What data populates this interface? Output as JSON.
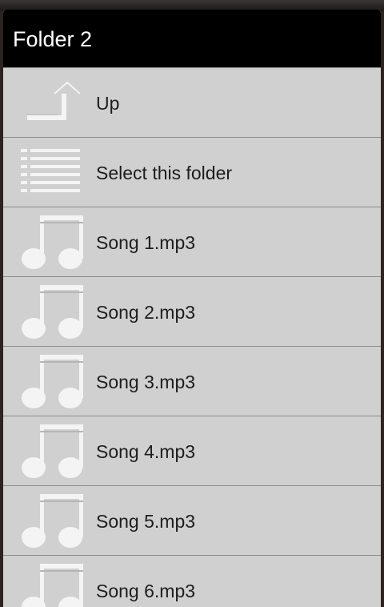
{
  "dialog": {
    "title": "Folder 2"
  },
  "items": [
    {
      "label": "Up",
      "icon": "up-arrow-icon"
    },
    {
      "label": "Select this folder",
      "icon": "list-icon"
    },
    {
      "label": "Song 1.mp3",
      "icon": "music-note-icon"
    },
    {
      "label": "Song 2.mp3",
      "icon": "music-note-icon"
    },
    {
      "label": "Song 3.mp3",
      "icon": "music-note-icon"
    },
    {
      "label": "Song 4.mp3",
      "icon": "music-note-icon"
    },
    {
      "label": "Song 5.mp3",
      "icon": "music-note-icon"
    },
    {
      "label": "Song 6.mp3",
      "icon": "music-note-icon"
    }
  ],
  "colors": {
    "title_background": "#000000",
    "list_background": "#d0d0d0",
    "icon_fill": "#f2f2f2",
    "divider": "#8c8c8c"
  }
}
